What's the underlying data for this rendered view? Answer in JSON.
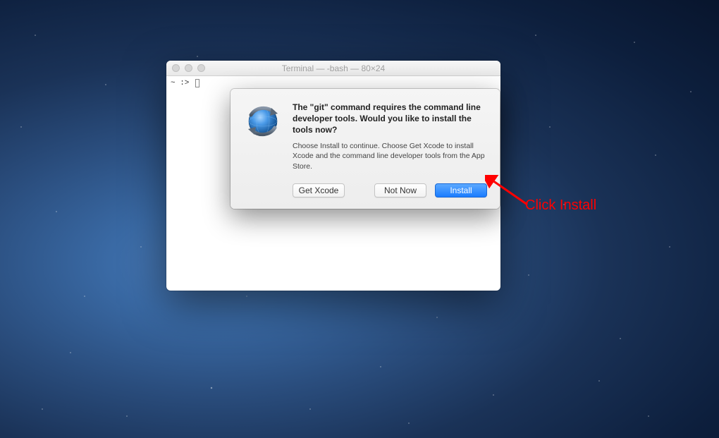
{
  "desktop": {},
  "terminal": {
    "title": "Terminal — -bash — 80×24",
    "prompt": "~ :> "
  },
  "dialog": {
    "heading": "The \"git\" command requires the command line developer tools. Would you like to install the tools now?",
    "description": "Choose Install to continue. Choose Get Xcode to install Xcode and the command line developer tools from the App Store.",
    "buttons": {
      "get_xcode": "Get Xcode",
      "not_now": "Not Now",
      "install": "Install"
    }
  },
  "annotation": {
    "label": "Click Install"
  }
}
